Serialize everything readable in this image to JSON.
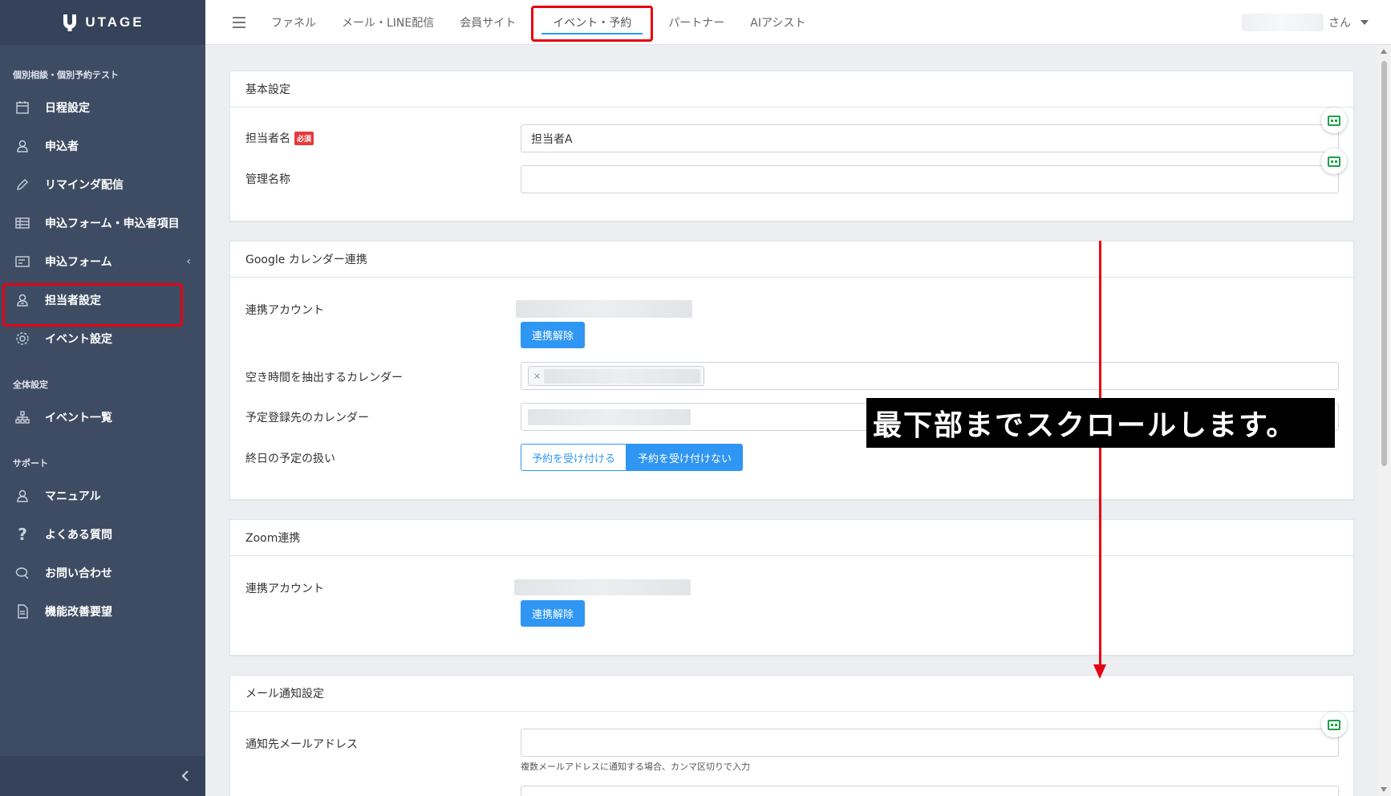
{
  "app": {
    "logo_text": "UTAGE"
  },
  "topnav": {
    "tabs": [
      {
        "label": "ファネル"
      },
      {
        "label": "メール・LINE配信"
      },
      {
        "label": "会員サイト"
      },
      {
        "label": "イベント・予約"
      },
      {
        "label": "パートナー"
      },
      {
        "label": "AIアシスト"
      }
    ],
    "active_tab": "イベント・予約",
    "user_suffix": "さん"
  },
  "sidebar": {
    "section1": "個別相談・個別予約テスト",
    "items1": [
      {
        "label": "日程設定",
        "icon": "calendar-icon"
      },
      {
        "label": "申込者",
        "icon": "user-icon"
      },
      {
        "label": "リマインダ配信",
        "icon": "pencil-icon"
      },
      {
        "label": "申込フォーム・申込者項目",
        "icon": "table-icon"
      },
      {
        "label": "申込フォーム",
        "icon": "form-icon"
      },
      {
        "label": "担当者設定",
        "icon": "staff-icon"
      },
      {
        "label": "イベント設定",
        "icon": "gear-icon"
      }
    ],
    "section2": "全体設定",
    "items2": [
      {
        "label": "イベント一覧",
        "icon": "sitemap-icon"
      }
    ],
    "section3": "サポート",
    "items3": [
      {
        "label": "マニュアル",
        "icon": "user-icon"
      },
      {
        "label": "よくある質問",
        "icon": "question-icon"
      },
      {
        "label": "お問い合わせ",
        "icon": "chat-icon"
      },
      {
        "label": "機能改善要望",
        "icon": "document-icon"
      }
    ]
  },
  "basic": {
    "title": "基本設定",
    "name_label": "担当者名",
    "required": "必須",
    "name_value": "担当者A",
    "manage_label": "管理名称",
    "manage_value": ""
  },
  "google": {
    "title": "Google カレンダー連携",
    "account_label": "連携アカウント",
    "unlink_button": "連携解除",
    "free_cal_label": "空き時間を抽出するカレンダー",
    "tag_remove": "×",
    "register_cal_label": "予定登録先のカレンダー",
    "allday_label": "終日の予定の扱い",
    "allday_accept": "予約を受け付ける",
    "allday_reject": "予約を受け付けない"
  },
  "zoom": {
    "title": "Zoom連携",
    "account_label": "連携アカウント",
    "unlink_button": "連携解除"
  },
  "mail": {
    "title": "メール通知設定",
    "to_label": "通知先メールアドレス",
    "to_value": "",
    "hint": "複数メールアドレスに通知する場合、カンマ区切りで入力"
  },
  "annotation": {
    "text": "最下部までスクロールします。"
  },
  "colors": {
    "accent": "#2f96f3",
    "sidebar": "#3e4c63",
    "highlight": "#e60012"
  }
}
